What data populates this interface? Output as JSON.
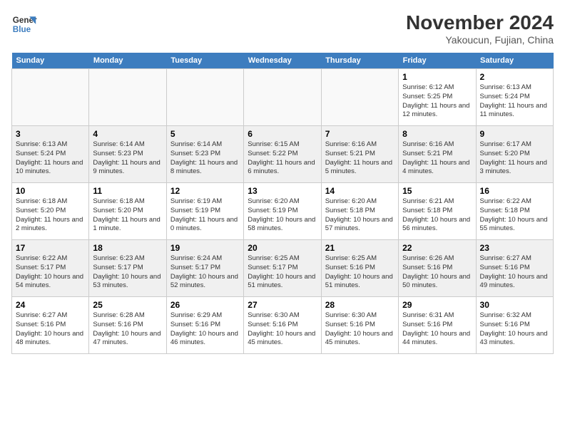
{
  "header": {
    "logo_text_line1": "General",
    "logo_text_line2": "Blue",
    "month_year": "November 2024",
    "location": "Yakoucun, Fujian, China"
  },
  "days_of_week": [
    "Sunday",
    "Monday",
    "Tuesday",
    "Wednesday",
    "Thursday",
    "Friday",
    "Saturday"
  ],
  "weeks": [
    {
      "days": [
        {
          "num": "",
          "info": ""
        },
        {
          "num": "",
          "info": ""
        },
        {
          "num": "",
          "info": ""
        },
        {
          "num": "",
          "info": ""
        },
        {
          "num": "",
          "info": ""
        },
        {
          "num": "1",
          "info": "Sunrise: 6:12 AM\nSunset: 5:25 PM\nDaylight: 11 hours and 12 minutes."
        },
        {
          "num": "2",
          "info": "Sunrise: 6:13 AM\nSunset: 5:24 PM\nDaylight: 11 hours and 11 minutes."
        }
      ]
    },
    {
      "days": [
        {
          "num": "3",
          "info": "Sunrise: 6:13 AM\nSunset: 5:24 PM\nDaylight: 11 hours and 10 minutes."
        },
        {
          "num": "4",
          "info": "Sunrise: 6:14 AM\nSunset: 5:23 PM\nDaylight: 11 hours and 9 minutes."
        },
        {
          "num": "5",
          "info": "Sunrise: 6:14 AM\nSunset: 5:23 PM\nDaylight: 11 hours and 8 minutes."
        },
        {
          "num": "6",
          "info": "Sunrise: 6:15 AM\nSunset: 5:22 PM\nDaylight: 11 hours and 6 minutes."
        },
        {
          "num": "7",
          "info": "Sunrise: 6:16 AM\nSunset: 5:21 PM\nDaylight: 11 hours and 5 minutes."
        },
        {
          "num": "8",
          "info": "Sunrise: 6:16 AM\nSunset: 5:21 PM\nDaylight: 11 hours and 4 minutes."
        },
        {
          "num": "9",
          "info": "Sunrise: 6:17 AM\nSunset: 5:20 PM\nDaylight: 11 hours and 3 minutes."
        }
      ]
    },
    {
      "days": [
        {
          "num": "10",
          "info": "Sunrise: 6:18 AM\nSunset: 5:20 PM\nDaylight: 11 hours and 2 minutes."
        },
        {
          "num": "11",
          "info": "Sunrise: 6:18 AM\nSunset: 5:20 PM\nDaylight: 11 hours and 1 minute."
        },
        {
          "num": "12",
          "info": "Sunrise: 6:19 AM\nSunset: 5:19 PM\nDaylight: 11 hours and 0 minutes."
        },
        {
          "num": "13",
          "info": "Sunrise: 6:20 AM\nSunset: 5:19 PM\nDaylight: 10 hours and 58 minutes."
        },
        {
          "num": "14",
          "info": "Sunrise: 6:20 AM\nSunset: 5:18 PM\nDaylight: 10 hours and 57 minutes."
        },
        {
          "num": "15",
          "info": "Sunrise: 6:21 AM\nSunset: 5:18 PM\nDaylight: 10 hours and 56 minutes."
        },
        {
          "num": "16",
          "info": "Sunrise: 6:22 AM\nSunset: 5:18 PM\nDaylight: 10 hours and 55 minutes."
        }
      ]
    },
    {
      "days": [
        {
          "num": "17",
          "info": "Sunrise: 6:22 AM\nSunset: 5:17 PM\nDaylight: 10 hours and 54 minutes."
        },
        {
          "num": "18",
          "info": "Sunrise: 6:23 AM\nSunset: 5:17 PM\nDaylight: 10 hours and 53 minutes."
        },
        {
          "num": "19",
          "info": "Sunrise: 6:24 AM\nSunset: 5:17 PM\nDaylight: 10 hours and 52 minutes."
        },
        {
          "num": "20",
          "info": "Sunrise: 6:25 AM\nSunset: 5:17 PM\nDaylight: 10 hours and 51 minutes."
        },
        {
          "num": "21",
          "info": "Sunrise: 6:25 AM\nSunset: 5:16 PM\nDaylight: 10 hours and 51 minutes."
        },
        {
          "num": "22",
          "info": "Sunrise: 6:26 AM\nSunset: 5:16 PM\nDaylight: 10 hours and 50 minutes."
        },
        {
          "num": "23",
          "info": "Sunrise: 6:27 AM\nSunset: 5:16 PM\nDaylight: 10 hours and 49 minutes."
        }
      ]
    },
    {
      "days": [
        {
          "num": "24",
          "info": "Sunrise: 6:27 AM\nSunset: 5:16 PM\nDaylight: 10 hours and 48 minutes."
        },
        {
          "num": "25",
          "info": "Sunrise: 6:28 AM\nSunset: 5:16 PM\nDaylight: 10 hours and 47 minutes."
        },
        {
          "num": "26",
          "info": "Sunrise: 6:29 AM\nSunset: 5:16 PM\nDaylight: 10 hours and 46 minutes."
        },
        {
          "num": "27",
          "info": "Sunrise: 6:30 AM\nSunset: 5:16 PM\nDaylight: 10 hours and 45 minutes."
        },
        {
          "num": "28",
          "info": "Sunrise: 6:30 AM\nSunset: 5:16 PM\nDaylight: 10 hours and 45 minutes."
        },
        {
          "num": "29",
          "info": "Sunrise: 6:31 AM\nSunset: 5:16 PM\nDaylight: 10 hours and 44 minutes."
        },
        {
          "num": "30",
          "info": "Sunrise: 6:32 AM\nSunset: 5:16 PM\nDaylight: 10 hours and 43 minutes."
        }
      ]
    }
  ]
}
